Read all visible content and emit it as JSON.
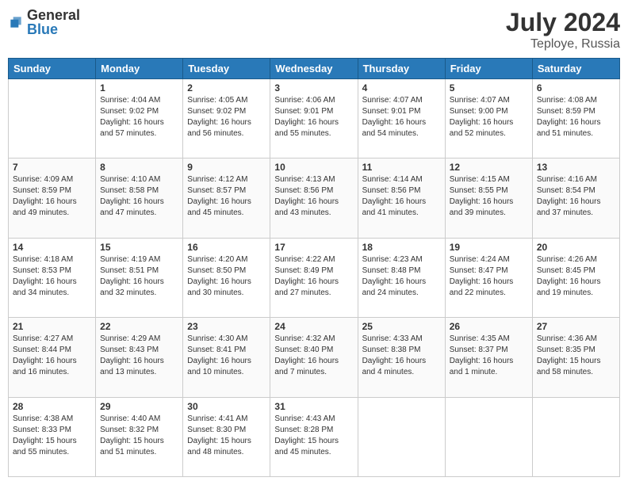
{
  "header": {
    "logo_general": "General",
    "logo_blue": "Blue",
    "month_year": "July 2024",
    "location": "Teploye, Russia"
  },
  "weekdays": [
    "Sunday",
    "Monday",
    "Tuesday",
    "Wednesday",
    "Thursday",
    "Friday",
    "Saturday"
  ],
  "weeks": [
    [
      {
        "day": "",
        "info": ""
      },
      {
        "day": "1",
        "info": "Sunrise: 4:04 AM\nSunset: 9:02 PM\nDaylight: 16 hours\nand 57 minutes."
      },
      {
        "day": "2",
        "info": "Sunrise: 4:05 AM\nSunset: 9:02 PM\nDaylight: 16 hours\nand 56 minutes."
      },
      {
        "day": "3",
        "info": "Sunrise: 4:06 AM\nSunset: 9:01 PM\nDaylight: 16 hours\nand 55 minutes."
      },
      {
        "day": "4",
        "info": "Sunrise: 4:07 AM\nSunset: 9:01 PM\nDaylight: 16 hours\nand 54 minutes."
      },
      {
        "day": "5",
        "info": "Sunrise: 4:07 AM\nSunset: 9:00 PM\nDaylight: 16 hours\nand 52 minutes."
      },
      {
        "day": "6",
        "info": "Sunrise: 4:08 AM\nSunset: 8:59 PM\nDaylight: 16 hours\nand 51 minutes."
      }
    ],
    [
      {
        "day": "7",
        "info": "Sunrise: 4:09 AM\nSunset: 8:59 PM\nDaylight: 16 hours\nand 49 minutes."
      },
      {
        "day": "8",
        "info": "Sunrise: 4:10 AM\nSunset: 8:58 PM\nDaylight: 16 hours\nand 47 minutes."
      },
      {
        "day": "9",
        "info": "Sunrise: 4:12 AM\nSunset: 8:57 PM\nDaylight: 16 hours\nand 45 minutes."
      },
      {
        "day": "10",
        "info": "Sunrise: 4:13 AM\nSunset: 8:56 PM\nDaylight: 16 hours\nand 43 minutes."
      },
      {
        "day": "11",
        "info": "Sunrise: 4:14 AM\nSunset: 8:56 PM\nDaylight: 16 hours\nand 41 minutes."
      },
      {
        "day": "12",
        "info": "Sunrise: 4:15 AM\nSunset: 8:55 PM\nDaylight: 16 hours\nand 39 minutes."
      },
      {
        "day": "13",
        "info": "Sunrise: 4:16 AM\nSunset: 8:54 PM\nDaylight: 16 hours\nand 37 minutes."
      }
    ],
    [
      {
        "day": "14",
        "info": "Sunrise: 4:18 AM\nSunset: 8:53 PM\nDaylight: 16 hours\nand 34 minutes."
      },
      {
        "day": "15",
        "info": "Sunrise: 4:19 AM\nSunset: 8:51 PM\nDaylight: 16 hours\nand 32 minutes."
      },
      {
        "day": "16",
        "info": "Sunrise: 4:20 AM\nSunset: 8:50 PM\nDaylight: 16 hours\nand 30 minutes."
      },
      {
        "day": "17",
        "info": "Sunrise: 4:22 AM\nSunset: 8:49 PM\nDaylight: 16 hours\nand 27 minutes."
      },
      {
        "day": "18",
        "info": "Sunrise: 4:23 AM\nSunset: 8:48 PM\nDaylight: 16 hours\nand 24 minutes."
      },
      {
        "day": "19",
        "info": "Sunrise: 4:24 AM\nSunset: 8:47 PM\nDaylight: 16 hours\nand 22 minutes."
      },
      {
        "day": "20",
        "info": "Sunrise: 4:26 AM\nSunset: 8:45 PM\nDaylight: 16 hours\nand 19 minutes."
      }
    ],
    [
      {
        "day": "21",
        "info": "Sunrise: 4:27 AM\nSunset: 8:44 PM\nDaylight: 16 hours\nand 16 minutes."
      },
      {
        "day": "22",
        "info": "Sunrise: 4:29 AM\nSunset: 8:43 PM\nDaylight: 16 hours\nand 13 minutes."
      },
      {
        "day": "23",
        "info": "Sunrise: 4:30 AM\nSunset: 8:41 PM\nDaylight: 16 hours\nand 10 minutes."
      },
      {
        "day": "24",
        "info": "Sunrise: 4:32 AM\nSunset: 8:40 PM\nDaylight: 16 hours\nand 7 minutes."
      },
      {
        "day": "25",
        "info": "Sunrise: 4:33 AM\nSunset: 8:38 PM\nDaylight: 16 hours\nand 4 minutes."
      },
      {
        "day": "26",
        "info": "Sunrise: 4:35 AM\nSunset: 8:37 PM\nDaylight: 16 hours\nand 1 minute."
      },
      {
        "day": "27",
        "info": "Sunrise: 4:36 AM\nSunset: 8:35 PM\nDaylight: 15 hours\nand 58 minutes."
      }
    ],
    [
      {
        "day": "28",
        "info": "Sunrise: 4:38 AM\nSunset: 8:33 PM\nDaylight: 15 hours\nand 55 minutes."
      },
      {
        "day": "29",
        "info": "Sunrise: 4:40 AM\nSunset: 8:32 PM\nDaylight: 15 hours\nand 51 minutes."
      },
      {
        "day": "30",
        "info": "Sunrise: 4:41 AM\nSunset: 8:30 PM\nDaylight: 15 hours\nand 48 minutes."
      },
      {
        "day": "31",
        "info": "Sunrise: 4:43 AM\nSunset: 8:28 PM\nDaylight: 15 hours\nand 45 minutes."
      },
      {
        "day": "",
        "info": ""
      },
      {
        "day": "",
        "info": ""
      },
      {
        "day": "",
        "info": ""
      }
    ]
  ]
}
